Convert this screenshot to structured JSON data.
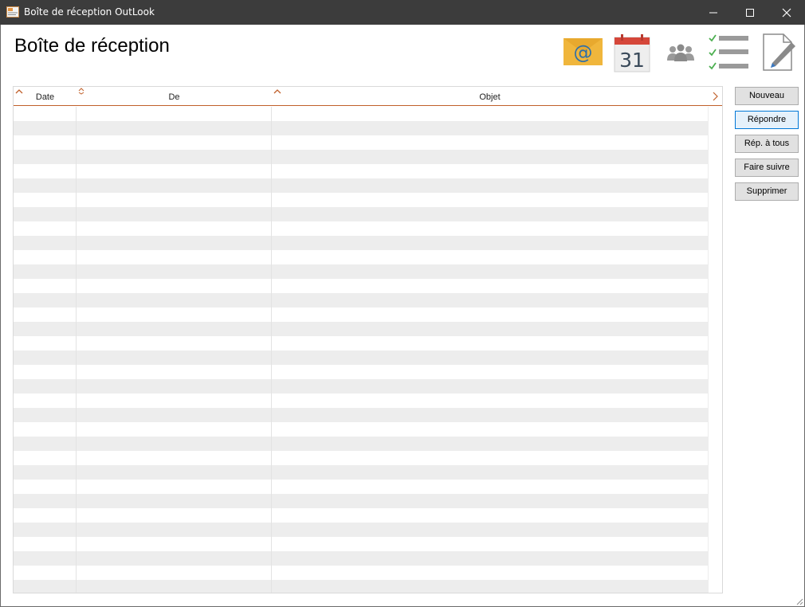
{
  "window": {
    "title": "Boîte de réception OutLook",
    "controls": [
      "minimize",
      "maximize",
      "close"
    ]
  },
  "header": {
    "title": "Boîte de réception"
  },
  "toolbar": {
    "icons": [
      "mail-icon",
      "calendar-icon",
      "contacts-icon",
      "tasks-icon",
      "notes-icon"
    ],
    "calendar_day": "31"
  },
  "grid": {
    "columns": [
      "Date",
      "De",
      "Objet"
    ],
    "rows": []
  },
  "actions": {
    "new": "Nouveau",
    "reply": "Répondre",
    "reply_all": "Rép. à tous",
    "forward": "Faire suivre",
    "delete": "Supprimer"
  },
  "colors": {
    "titlebar": "#3c3c3c",
    "accent": "#c0602a",
    "mail_yellow": "#f0b63c",
    "calendar_red": "#d5473a",
    "task_green": "#4caf50",
    "pen_blue": "#3a78c2"
  }
}
